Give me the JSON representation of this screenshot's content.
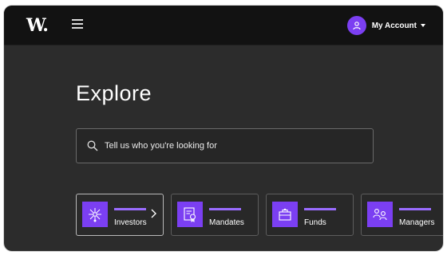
{
  "header": {
    "logo_text": "W.",
    "account_label": "My Account",
    "icons": [
      "hamburger-menu-icon",
      "user-icon",
      "caret-down-icon"
    ]
  },
  "main": {
    "title": "Explore",
    "search": {
      "placeholder": "Tell us who you're looking for"
    }
  },
  "categories": [
    {
      "label": "Investors",
      "icon": "network-icon",
      "selected": true
    },
    {
      "label": "Mandates",
      "icon": "certificate-icon",
      "selected": false
    },
    {
      "label": "Funds",
      "icon": "briefcase-icon",
      "selected": false
    },
    {
      "label": "Managers",
      "icon": "people-icon",
      "selected": false
    }
  ],
  "colors": {
    "accent": "#7b3ff2",
    "accent_bar": "#9a6cff",
    "background": "#2c2c2c",
    "topbar": "#121212"
  }
}
